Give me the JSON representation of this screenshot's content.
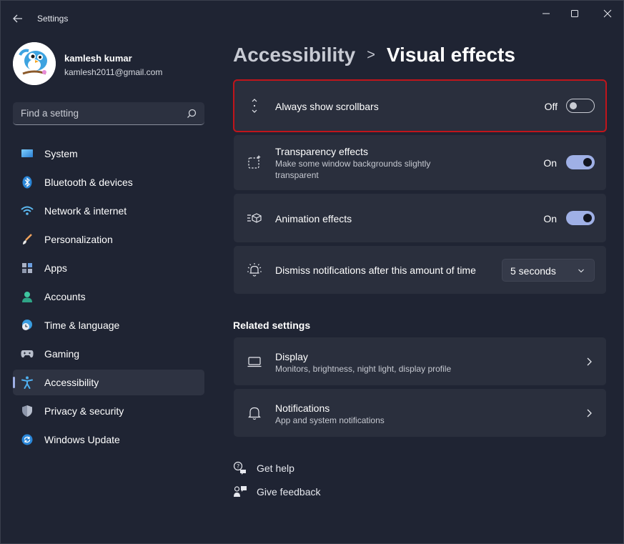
{
  "window": {
    "title": "Settings"
  },
  "profile": {
    "name": "kamlesh kumar",
    "email": "kamlesh2011@gmail.com"
  },
  "search": {
    "placeholder": "Find a setting"
  },
  "sidebar": {
    "items": [
      {
        "label": "System",
        "icon": "system-icon",
        "active": false
      },
      {
        "label": "Bluetooth & devices",
        "icon": "bluetooth-icon",
        "active": false
      },
      {
        "label": "Network & internet",
        "icon": "wifi-icon",
        "active": false
      },
      {
        "label": "Personalization",
        "icon": "brush-icon",
        "active": false
      },
      {
        "label": "Apps",
        "icon": "apps-icon",
        "active": false
      },
      {
        "label": "Accounts",
        "icon": "person-icon",
        "active": false
      },
      {
        "label": "Time & language",
        "icon": "globe-clock-icon",
        "active": false
      },
      {
        "label": "Gaming",
        "icon": "gamepad-icon",
        "active": false
      },
      {
        "label": "Accessibility",
        "icon": "accessibility-icon",
        "active": true
      },
      {
        "label": "Privacy & security",
        "icon": "shield-icon",
        "active": false
      },
      {
        "label": "Windows Update",
        "icon": "update-icon",
        "active": false
      }
    ]
  },
  "breadcrumb": {
    "parent": "Accessibility",
    "separator": ">",
    "current": "Visual effects"
  },
  "settings": [
    {
      "title": "Always show scrollbars",
      "state": "Off",
      "toggle_on": false,
      "highlighted": true
    },
    {
      "title": "Transparency effects",
      "subtitle_line1": "Make some window backgrounds slightly",
      "subtitle_line2": "transparent",
      "state": "On",
      "toggle_on": true
    },
    {
      "title": "Animation effects",
      "state": "On",
      "toggle_on": true
    },
    {
      "title": "Dismiss notifications after this amount of time",
      "dropdown_value": "5 seconds"
    }
  ],
  "related": {
    "heading": "Related settings",
    "items": [
      {
        "title": "Display",
        "subtitle": "Monitors, brightness, night light, display profile"
      },
      {
        "title": "Notifications",
        "subtitle": "App and system notifications"
      }
    ]
  },
  "footer": {
    "get_help": "Get help",
    "give_feedback": "Give feedback"
  },
  "colors": {
    "background": "#1f2433",
    "card": "#2a2f3d",
    "accent": "#9fb0e6",
    "highlight": "#c0151b"
  }
}
